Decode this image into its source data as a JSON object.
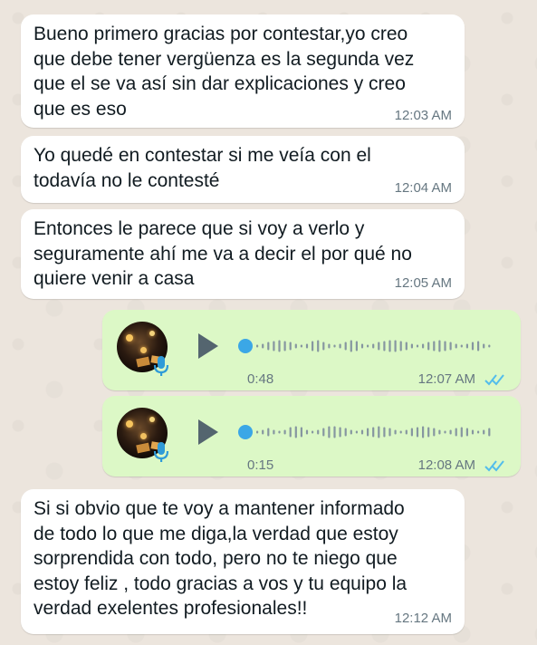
{
  "theme": {
    "incoming_bg": "#ffffff",
    "outgoing_bg": "#dcf8c6",
    "read_tick_color": "#53bdeb",
    "wallpaper": "#ece5dd"
  },
  "messages": [
    {
      "type": "text",
      "direction": "incoming",
      "text": "Bueno primero gracias por contestar,yo creo\nque debe tener vergüenza es la segunda vez\nque el se va así sin dar explicaciones y creo\nque es eso",
      "time": "12:03 AM"
    },
    {
      "type": "text",
      "direction": "incoming",
      "text": "Yo quedé en contestar si me veía con el\ntodavía no le contesté",
      "time": "12:04 AM"
    },
    {
      "type": "text",
      "direction": "incoming",
      "text": "Entonces le parece que si voy a verlo y\nseguramente ahí me va a decir el por qué no\nquiere venir a casa",
      "time": "12:05 AM"
    },
    {
      "type": "voice",
      "direction": "outgoing",
      "duration": "0:48",
      "time": "12:07 AM",
      "status": "read",
      "icons": [
        "avatar",
        "mic-icon",
        "play-icon",
        "double-check-icon"
      ]
    },
    {
      "type": "voice",
      "direction": "outgoing",
      "duration": "0:15",
      "time": "12:08 AM",
      "status": "read",
      "icons": [
        "avatar",
        "mic-icon",
        "play-icon",
        "double-check-icon"
      ]
    },
    {
      "type": "text",
      "direction": "incoming",
      "text": "Si si obvio que te voy a mantener informado\nde todo lo que me diga,la verdad que estoy\nsorprendida con todo, pero no te niego que\nestoy feliz , todo gracias a vos y tu equipo la\nverdad exelentes profesionales!!",
      "time": "12:12 AM"
    }
  ]
}
